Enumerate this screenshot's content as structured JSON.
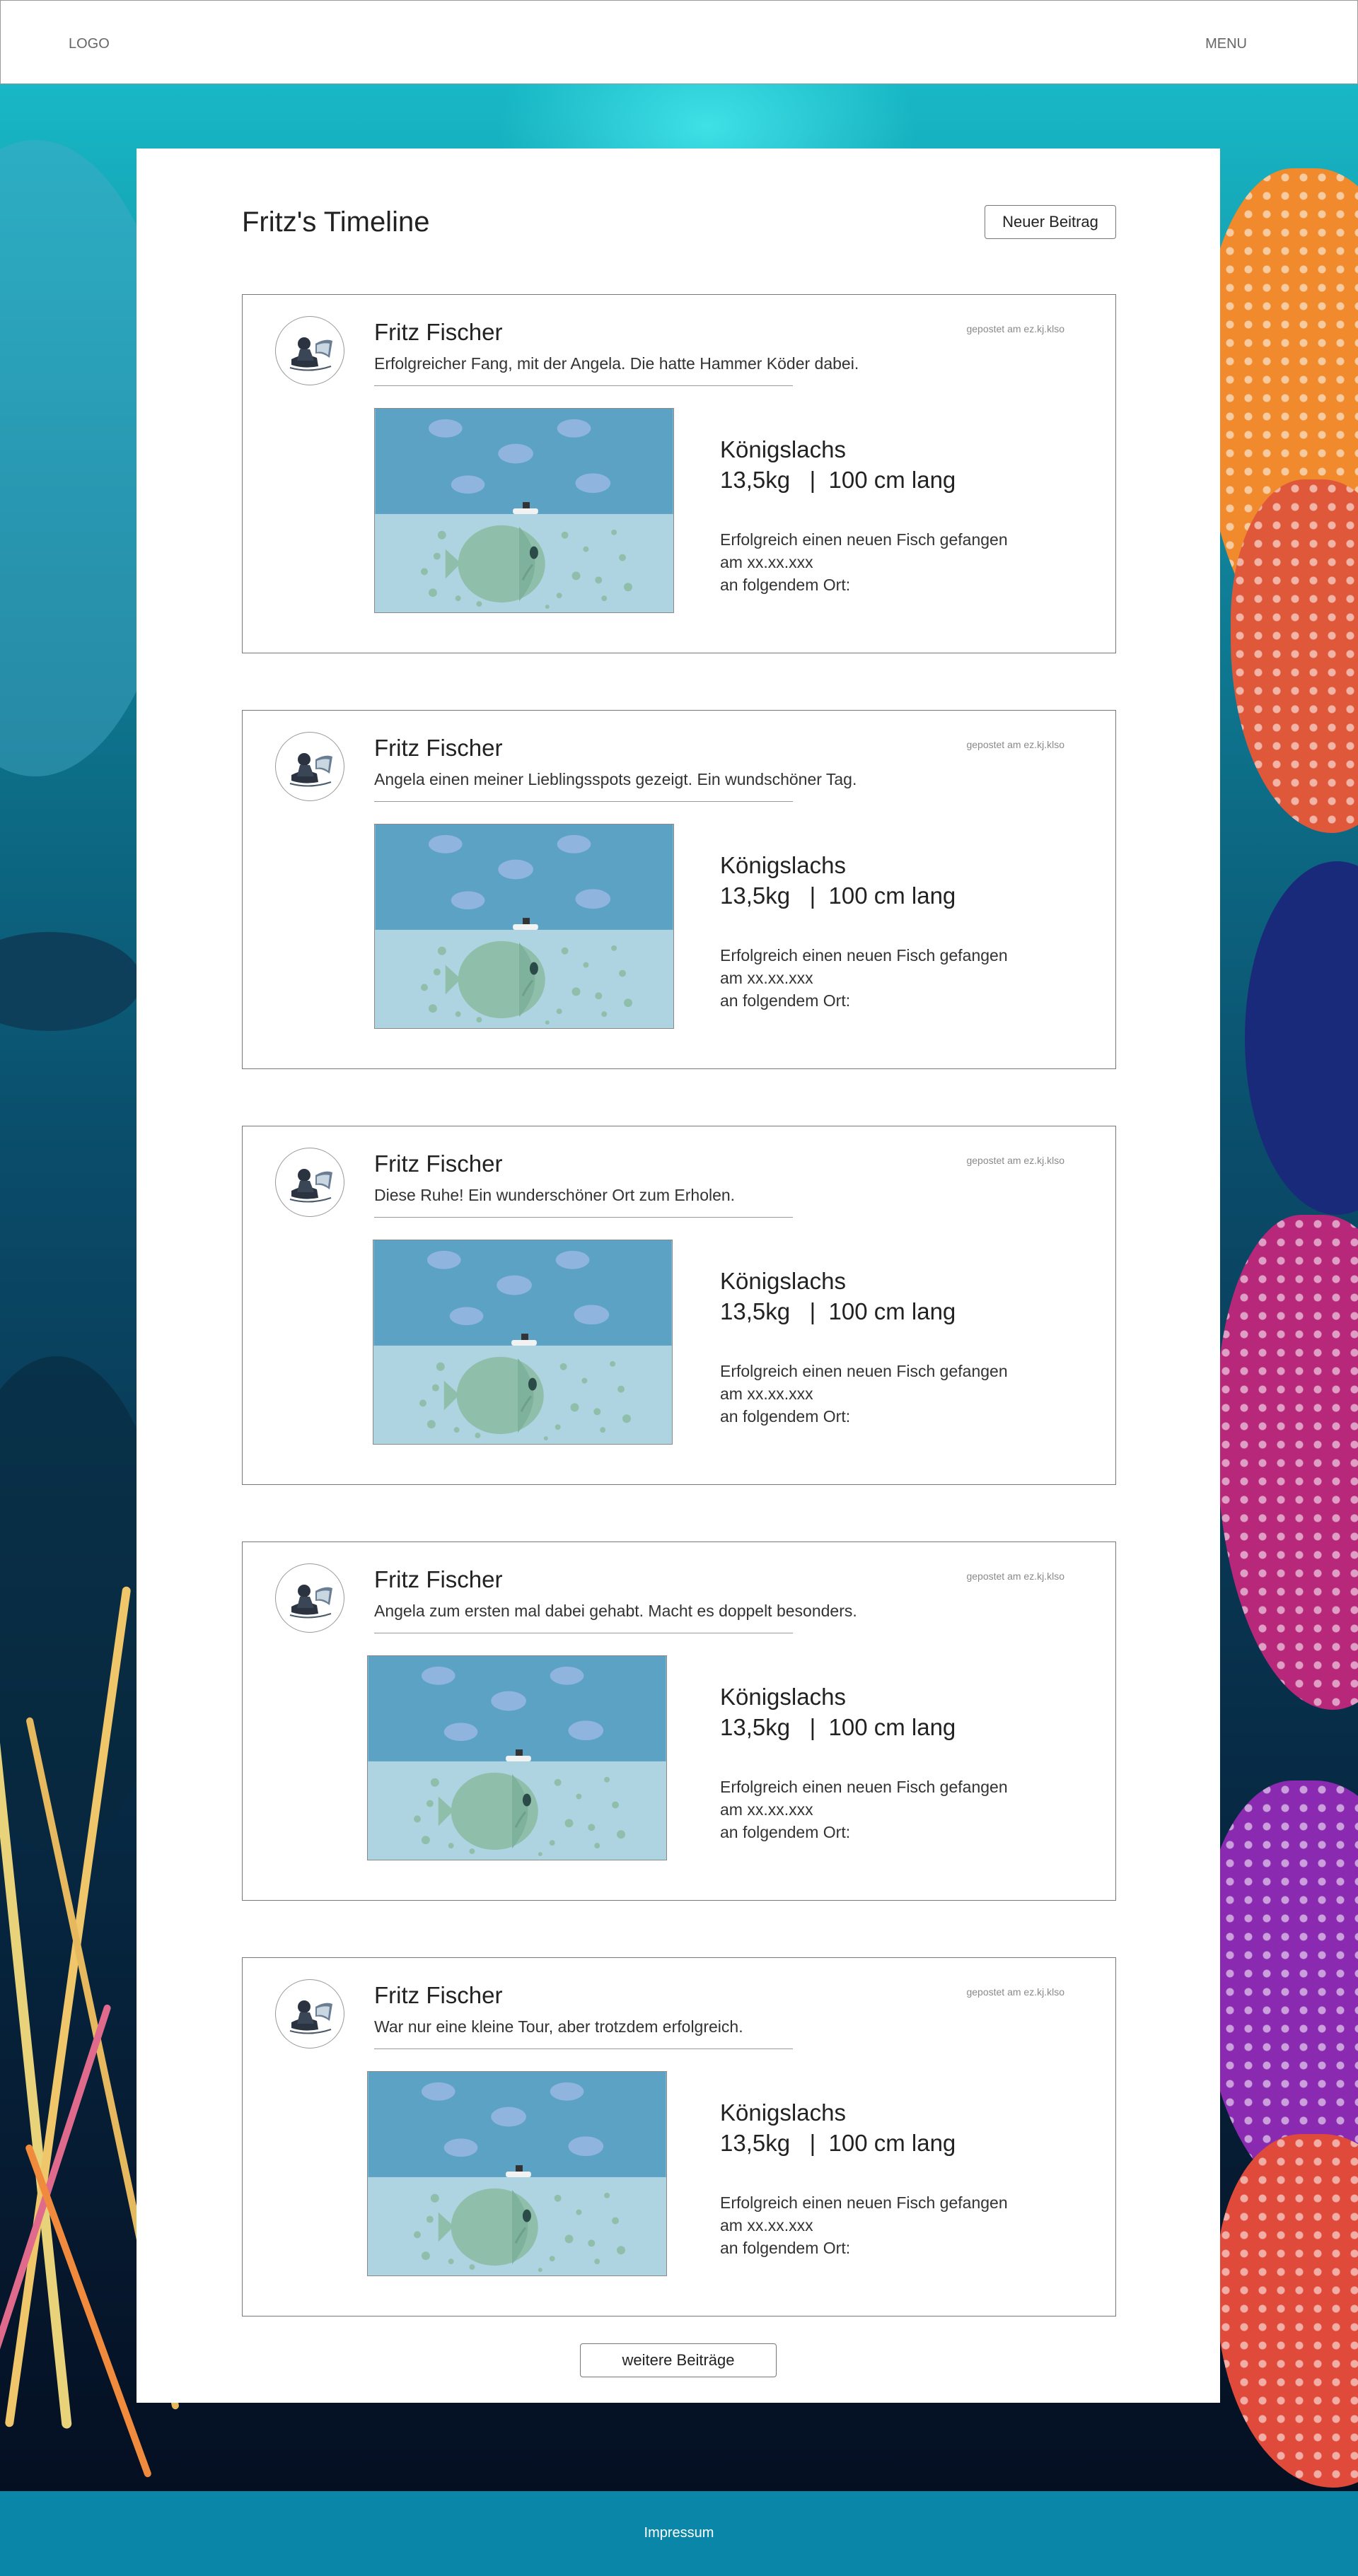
{
  "header": {
    "logo": "LOGO",
    "menu": "MENU"
  },
  "main": {
    "title": "Fritz's Timeline",
    "new_post_label": "Neuer Beitrag"
  },
  "posts": [
    {
      "author": "Fritz Fischer",
      "date": "gepostet am ez.kj.klso",
      "text": "Erfolgreicher Fang, mit der Angela. Die hatte Hammer Köder dabei.",
      "fish": "Königslachs",
      "stats": "13,5kg   |  100 cm lang",
      "desc1": "Erfolgreich einen neuen Fisch gefangen",
      "desc2": "am xx.xx.xxx",
      "desc3": "an folgendem Ort:"
    },
    {
      "author": "Fritz Fischer",
      "date": "gepostet am ez.kj.klso",
      "text": "Angela einen meiner Lieblingsspots gezeigt. Ein wundschöner Tag.",
      "fish": "Königslachs",
      "stats": "13,5kg   |  100 cm lang",
      "desc1": "Erfolgreich einen neuen Fisch gefangen",
      "desc2": "am xx.xx.xxx",
      "desc3": "an folgendem Ort:"
    },
    {
      "author": "Fritz Fischer",
      "date": "gepostet am ez.kj.klso",
      "text": "Diese Ruhe! Ein wunderschöner Ort zum Erholen.",
      "fish": "Königslachs",
      "stats": "13,5kg   |  100 cm lang",
      "desc1": "Erfolgreich einen neuen Fisch gefangen",
      "desc2": "am xx.xx.xxx",
      "desc3": "an folgendem Ort:"
    },
    {
      "author": "Fritz Fischer",
      "date": "gepostet am ez.kj.klso",
      "text": "Angela zum ersten mal dabei gehabt. Macht es doppelt besonders.",
      "fish": "Königslachs",
      "stats": "13,5kg   |  100 cm lang",
      "desc1": "Erfolgreich einen neuen Fisch gefangen",
      "desc2": "am xx.xx.xxx",
      "desc3": "an folgendem Ort:"
    },
    {
      "author": "Fritz Fischer",
      "date": "gepostet am ez.kj.klso",
      "text": "War nur eine kleine Tour, aber trotzdem erfolgreich.",
      "fish": "Königslachs",
      "stats": "13,5kg   |  100 cm lang",
      "desc1": "Erfolgreich einen neuen Fisch gefangen",
      "desc2": "am xx.xx.xxx",
      "desc3": "an folgendem Ort:"
    }
  ],
  "more_label": "weitere Beiträge",
  "footer": {
    "impressum": "Impressum"
  },
  "colors": {
    "footer": "#0a86a8",
    "sky": "#5ba2c5",
    "water": "#aed3e1",
    "fish": "#8fbfab"
  },
  "icons": {
    "avatar": "angler-avatar-icon",
    "image": "fish-catch-illustration"
  }
}
